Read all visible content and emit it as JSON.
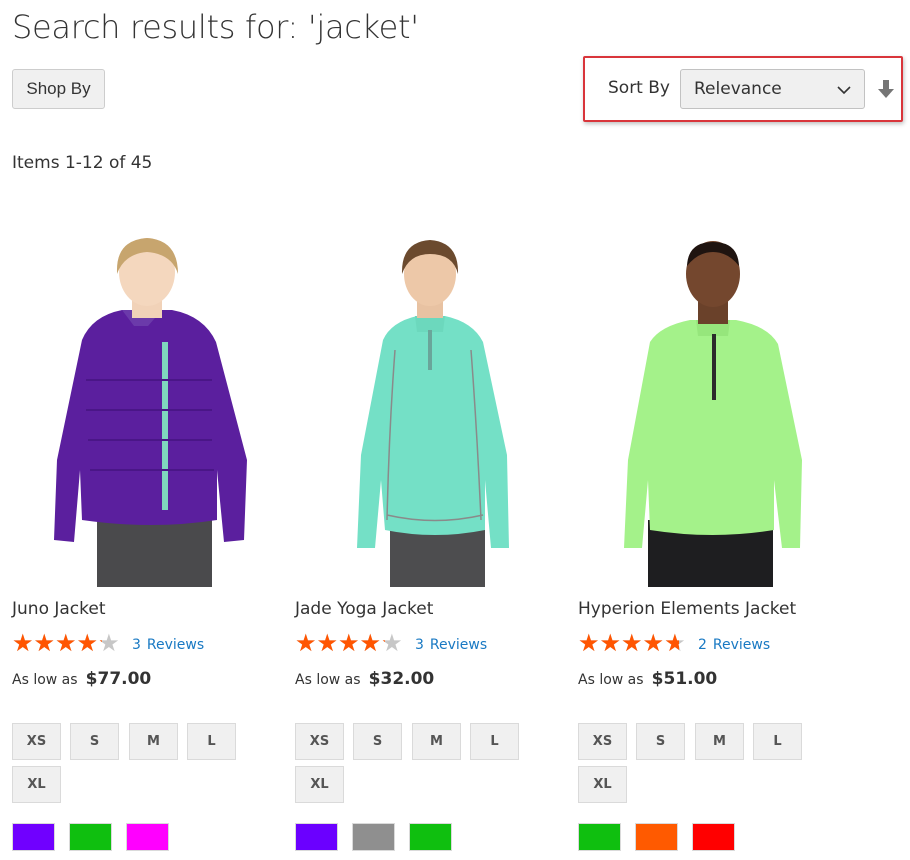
{
  "page": {
    "title": "Search results for: 'jacket'"
  },
  "toolbar": {
    "shop_by_label": "Shop By",
    "sort_label": "Sort By",
    "sort_selected": "Relevance",
    "sort_direction_icon": "arrow-down-icon",
    "amount_text": "Items 1-12 of 45",
    "highlight_color": "#d9353b"
  },
  "products": [
    {
      "name": "Juno Jacket",
      "rating_percent": 80,
      "review_count": "3",
      "review_word": "Reviews",
      "price_label": "As low as",
      "price": "$77.00",
      "sizes": [
        "XS",
        "S",
        "M",
        "L",
        "XL"
      ],
      "colors": [
        "#7000ff",
        "#0fbf0f",
        "#ff00ff"
      ]
    },
    {
      "name": "Jade Yoga Jacket",
      "rating_percent": 80,
      "review_count": "3",
      "review_word": "Reviews",
      "price_label": "As low as",
      "price": "$32.00",
      "sizes": [
        "XS",
        "S",
        "M",
        "L",
        "XL"
      ],
      "colors": [
        "#6b00ff",
        "#8f8f8f",
        "#0fbf0f"
      ]
    },
    {
      "name": "Hyperion Elements Jacket",
      "rating_percent": 90,
      "review_count": "2",
      "review_word": "Reviews",
      "price_label": "As low as",
      "price": "$51.00",
      "sizes": [
        "XS",
        "S",
        "M",
        "L",
        "XL"
      ],
      "colors": [
        "#0fbf0f",
        "#ff5a00",
        "#ff0000"
      ]
    }
  ],
  "colors": {
    "star": "#ff5501",
    "star_empty": "#c7c7c7",
    "link": "#1979c3"
  }
}
